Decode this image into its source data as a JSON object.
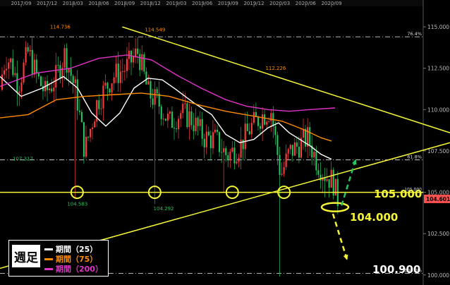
{
  "chart_data": {
    "type": "candlestick",
    "x_ticks": [
      "2017/09",
      "2017/12",
      "2018/03",
      "2018/06",
      "2018/09",
      "2018/12",
      "2019/03",
      "2019/06",
      "2019/09",
      "2019/12",
      "2020/03",
      "2020/06",
      "2020/09"
    ],
    "y_ticks": [
      "115.000",
      "112.500",
      "110.000",
      "107.500",
      "105.000",
      "102.500",
      "100.000"
    ],
    "ylim": [
      99.65,
      116.2
    ],
    "price_labels": [
      {
        "text": "114.736",
        "x": "2018/01",
        "y": 114.736,
        "color": "#ff8c00"
      },
      {
        "text": "114.549",
        "x": "2018/12",
        "y": 114.549,
        "color": "#ff8c00"
      },
      {
        "text": "112.226",
        "x": "2020/02",
        "y": 112.226,
        "color": "#ff8c00"
      },
      {
        "text": "107.317",
        "x": "2017/09",
        "y": 107.317,
        "color": "#22c55e"
      },
      {
        "text": "104.583",
        "x": "2018/03",
        "y": 104.583,
        "color": "#22c55e"
      },
      {
        "text": "104.292",
        "x": "2019/01",
        "y": 104.292,
        "color": "#22c55e"
      }
    ],
    "fib_levels": [
      {
        "label": "76.4%",
        "y": 114.4
      },
      {
        "label": "61.8%",
        "y": 106.96
      },
      {
        "label": "100.0%",
        "y": 100.1
      }
    ],
    "support_line": {
      "y": 105.0,
      "label": "105.000"
    },
    "level_labels": [
      {
        "text": "105.000",
        "y": 105.0,
        "color": "#f5f538"
      },
      {
        "text": "104.000",
        "y": 104.0,
        "color": "#f5f538"
      },
      {
        "text": "100.900",
        "y": 100.9,
        "color": "#ffffff"
      }
    ],
    "trendlines": [
      {
        "from": {
          "x": "2018/12",
          "y": 115.0
        },
        "to": {
          "x": "2020/12",
          "y": 108.6
        },
        "color": "#f5f538"
      },
      {
        "from": {
          "x": "2017/09",
          "y": 100.4
        },
        "to": {
          "x": "2020/12",
          "y": 108.0
        },
        "color": "#f5f538"
      }
    ],
    "arrows": [
      {
        "from": {
          "x": "2020/10",
          "y": 104.2
        },
        "to": {
          "x": "2020/11",
          "y": 107.0
        },
        "color": "#22c55e"
      },
      {
        "from": {
          "x": "2020/09",
          "y": 103.7
        },
        "to": {
          "x": "2020/10",
          "y": 100.9
        },
        "color": "#f5f538"
      }
    ],
    "current_price": {
      "value": 104.601,
      "label": "104.601",
      "color": "#ff5050"
    },
    "series": [
      {
        "name": "期間（25）",
        "color": "#ffffff"
      },
      {
        "name": "期間（75）",
        "color": "#ff8c00"
      },
      {
        "name": "期間（200）",
        "color": "#e033c8"
      }
    ]
  },
  "legend": {
    "tag": "週足",
    "items": [
      "期間（25）",
      "期間（75）",
      "期間（200）"
    ]
  },
  "colors": {
    "up": "#ff3b3b",
    "down": "#22c55e",
    "support": "#f5f538"
  }
}
